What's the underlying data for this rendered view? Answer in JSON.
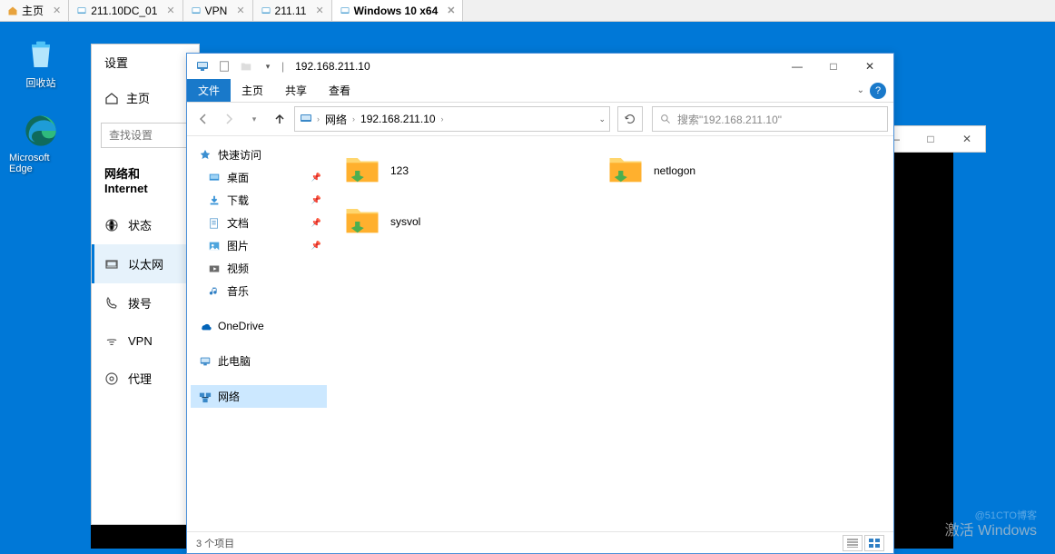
{
  "vm_tabs": [
    {
      "label": "主页",
      "icon": "home"
    },
    {
      "label": "211.10DC_01",
      "icon": "vm"
    },
    {
      "label": "VPN",
      "icon": "vm"
    },
    {
      "label": "211.11",
      "icon": "vm"
    },
    {
      "label": "Windows 10 x64",
      "icon": "vm",
      "active": true
    }
  ],
  "desktop": {
    "recycle_bin": "回收站",
    "edge": "Microsoft Edge"
  },
  "settings": {
    "title": "设置",
    "home": "主页",
    "search_placeholder": "查找设置",
    "section": "网络和 Internet",
    "items": [
      {
        "label": "状态",
        "icon": "status"
      },
      {
        "label": "以太网",
        "icon": "ethernet",
        "active": true
      },
      {
        "label": "拨号",
        "icon": "dialup"
      },
      {
        "label": "VPN",
        "icon": "vpn"
      },
      {
        "label": "代理",
        "icon": "proxy"
      }
    ]
  },
  "explorer": {
    "title": "192.168.211.10",
    "ribbon": {
      "file": "文件",
      "home": "主页",
      "share": "共享",
      "view": "查看"
    },
    "breadcrumb": {
      "root": "网络",
      "current": "192.168.211.10"
    },
    "search_placeholder": "搜索\"192.168.211.10\"",
    "nav_pane": {
      "quick_access": "快速访问",
      "desktop": "桌面",
      "downloads": "下载",
      "documents": "文档",
      "pictures": "图片",
      "videos": "视频",
      "music": "音乐",
      "onedrive": "OneDrive",
      "this_pc": "此电脑",
      "network": "网络"
    },
    "folders": [
      {
        "name": "123"
      },
      {
        "name": "netlogon"
      },
      {
        "name": "sysvol"
      }
    ],
    "status": "3 个项目"
  },
  "watermark": {
    "activate": "激活 Windows",
    "cto": "@51CTO博客"
  }
}
